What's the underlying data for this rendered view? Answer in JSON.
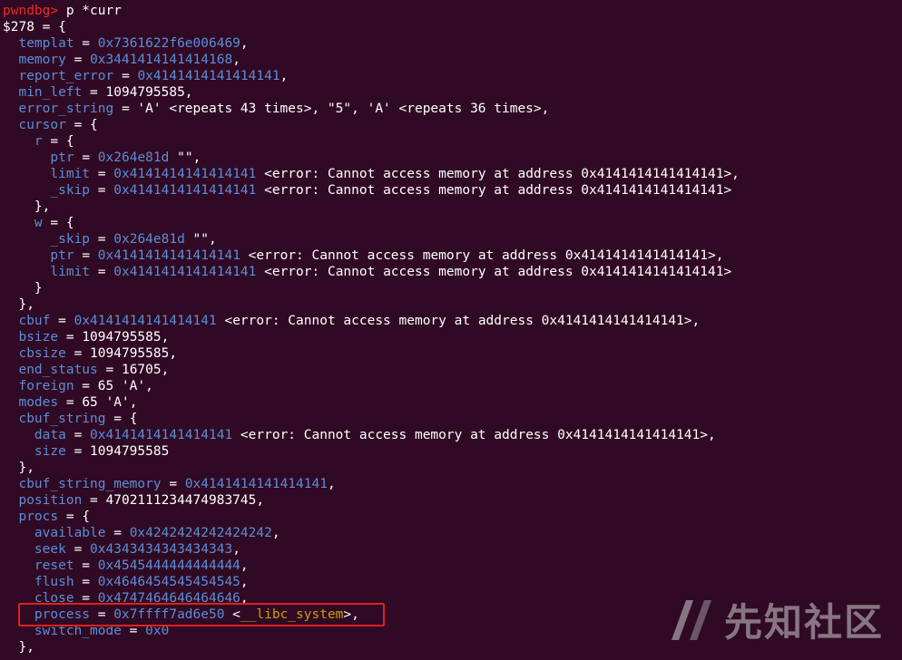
{
  "terminal": {
    "lines": [
      [
        {
          "t": "pwndbg>",
          "c": "prompt"
        },
        {
          "t": " p *curr",
          "c": "text"
        }
      ],
      [
        {
          "t": "$278 = {",
          "c": "text"
        }
      ],
      [
        {
          "t": "  ",
          "c": "text"
        },
        {
          "t": "templat",
          "c": "field"
        },
        {
          "t": " = ",
          "c": "text"
        },
        {
          "t": "0x7361622f6e006469",
          "c": "addr"
        },
        {
          "t": ",",
          "c": "text"
        }
      ],
      [
        {
          "t": "  ",
          "c": "text"
        },
        {
          "t": "memory",
          "c": "field"
        },
        {
          "t": " = ",
          "c": "text"
        },
        {
          "t": "0x3441414141414168",
          "c": "addr"
        },
        {
          "t": ",",
          "c": "text"
        }
      ],
      [
        {
          "t": "  ",
          "c": "text"
        },
        {
          "t": "report_error",
          "c": "field"
        },
        {
          "t": " = ",
          "c": "text"
        },
        {
          "t": "0x4141414141414141",
          "c": "addr"
        },
        {
          "t": ",",
          "c": "text"
        }
      ],
      [
        {
          "t": "  ",
          "c": "text"
        },
        {
          "t": "min_left",
          "c": "field"
        },
        {
          "t": " = 1094795585,",
          "c": "text"
        }
      ],
      [
        {
          "t": "  ",
          "c": "text"
        },
        {
          "t": "error_string",
          "c": "field"
        },
        {
          "t": " = 'A' <repeats 43 times>, \"5\", 'A' <repeats 36 times>,",
          "c": "text"
        }
      ],
      [
        {
          "t": "  ",
          "c": "text"
        },
        {
          "t": "cursor",
          "c": "field"
        },
        {
          "t": " = {",
          "c": "text"
        }
      ],
      [
        {
          "t": "    ",
          "c": "text"
        },
        {
          "t": "r",
          "c": "field"
        },
        {
          "t": " = {",
          "c": "text"
        }
      ],
      [
        {
          "t": "      ",
          "c": "text"
        },
        {
          "t": "ptr",
          "c": "field"
        },
        {
          "t": " = ",
          "c": "text"
        },
        {
          "t": "0x264e81d",
          "c": "addr"
        },
        {
          "t": " \"\",",
          "c": "text"
        }
      ],
      [
        {
          "t": "      ",
          "c": "text"
        },
        {
          "t": "limit",
          "c": "field"
        },
        {
          "t": " = ",
          "c": "text"
        },
        {
          "t": "0x4141414141414141",
          "c": "addr"
        },
        {
          "t": " <error: Cannot access memory at address 0x4141414141414141>,",
          "c": "text"
        }
      ],
      [
        {
          "t": "      ",
          "c": "text"
        },
        {
          "t": "_skip",
          "c": "field"
        },
        {
          "t": " = ",
          "c": "text"
        },
        {
          "t": "0x4141414141414141",
          "c": "addr"
        },
        {
          "t": " <error: Cannot access memory at address 0x4141414141414141>",
          "c": "text"
        }
      ],
      [
        {
          "t": "    },",
          "c": "text"
        }
      ],
      [
        {
          "t": "    ",
          "c": "text"
        },
        {
          "t": "w",
          "c": "field"
        },
        {
          "t": " = {",
          "c": "text"
        }
      ],
      [
        {
          "t": "      ",
          "c": "text"
        },
        {
          "t": "_skip",
          "c": "field"
        },
        {
          "t": " = ",
          "c": "text"
        },
        {
          "t": "0x264e81d",
          "c": "addr"
        },
        {
          "t": " \"\",",
          "c": "text"
        }
      ],
      [
        {
          "t": "      ",
          "c": "text"
        },
        {
          "t": "ptr",
          "c": "field"
        },
        {
          "t": " = ",
          "c": "text"
        },
        {
          "t": "0x4141414141414141",
          "c": "addr"
        },
        {
          "t": " <error: Cannot access memory at address 0x4141414141414141>,",
          "c": "text"
        }
      ],
      [
        {
          "t": "      ",
          "c": "text"
        },
        {
          "t": "limit",
          "c": "field"
        },
        {
          "t": " = ",
          "c": "text"
        },
        {
          "t": "0x4141414141414141",
          "c": "addr"
        },
        {
          "t": " <error: Cannot access memory at address 0x4141414141414141>",
          "c": "text"
        }
      ],
      [
        {
          "t": "    }",
          "c": "text"
        }
      ],
      [
        {
          "t": "  },",
          "c": "text"
        }
      ],
      [
        {
          "t": "  ",
          "c": "text"
        },
        {
          "t": "cbuf",
          "c": "field"
        },
        {
          "t": " = ",
          "c": "text"
        },
        {
          "t": "0x4141414141414141",
          "c": "addr"
        },
        {
          "t": " <error: Cannot access memory at address 0x4141414141414141>,",
          "c": "text"
        }
      ],
      [
        {
          "t": "  ",
          "c": "text"
        },
        {
          "t": "bsize",
          "c": "field"
        },
        {
          "t": " = 1094795585,",
          "c": "text"
        }
      ],
      [
        {
          "t": "  ",
          "c": "text"
        },
        {
          "t": "cbsize",
          "c": "field"
        },
        {
          "t": " = 1094795585,",
          "c": "text"
        }
      ],
      [
        {
          "t": "  ",
          "c": "text"
        },
        {
          "t": "end_status",
          "c": "field"
        },
        {
          "t": " = 16705,",
          "c": "text"
        }
      ],
      [
        {
          "t": "  ",
          "c": "text"
        },
        {
          "t": "foreign",
          "c": "field"
        },
        {
          "t": " = 65 'A',",
          "c": "text"
        }
      ],
      [
        {
          "t": "  ",
          "c": "text"
        },
        {
          "t": "modes",
          "c": "field"
        },
        {
          "t": " = 65 'A',",
          "c": "text"
        }
      ],
      [
        {
          "t": "  ",
          "c": "text"
        },
        {
          "t": "cbuf_string",
          "c": "field"
        },
        {
          "t": " = {",
          "c": "text"
        }
      ],
      [
        {
          "t": "    ",
          "c": "text"
        },
        {
          "t": "data",
          "c": "field"
        },
        {
          "t": " = ",
          "c": "text"
        },
        {
          "t": "0x4141414141414141",
          "c": "addr"
        },
        {
          "t": " <error: Cannot access memory at address 0x4141414141414141>,",
          "c": "text"
        }
      ],
      [
        {
          "t": "    ",
          "c": "text"
        },
        {
          "t": "size",
          "c": "field"
        },
        {
          "t": " = 1094795585",
          "c": "text"
        }
      ],
      [
        {
          "t": "  },",
          "c": "text"
        }
      ],
      [
        {
          "t": "  ",
          "c": "text"
        },
        {
          "t": "cbuf_string_memory",
          "c": "field"
        },
        {
          "t": " = ",
          "c": "text"
        },
        {
          "t": "0x4141414141414141",
          "c": "addr"
        },
        {
          "t": ",",
          "c": "text"
        }
      ],
      [
        {
          "t": "  ",
          "c": "text"
        },
        {
          "t": "position",
          "c": "field"
        },
        {
          "t": " = 4702111234474983745,",
          "c": "text"
        }
      ],
      [
        {
          "t": "  ",
          "c": "text"
        },
        {
          "t": "procs",
          "c": "field"
        },
        {
          "t": " = {",
          "c": "text"
        }
      ],
      [
        {
          "t": "    ",
          "c": "text"
        },
        {
          "t": "available",
          "c": "field"
        },
        {
          "t": " = ",
          "c": "text"
        },
        {
          "t": "0x4242424242424242",
          "c": "addr"
        },
        {
          "t": ",",
          "c": "text"
        }
      ],
      [
        {
          "t": "    ",
          "c": "text"
        },
        {
          "t": "seek",
          "c": "field"
        },
        {
          "t": " = ",
          "c": "text"
        },
        {
          "t": "0x4343434343434343",
          "c": "addr"
        },
        {
          "t": ",",
          "c": "text"
        }
      ],
      [
        {
          "t": "    ",
          "c": "text"
        },
        {
          "t": "reset",
          "c": "field"
        },
        {
          "t": " = ",
          "c": "text"
        },
        {
          "t": "0x4545444444444444",
          "c": "addr"
        },
        {
          "t": ",",
          "c": "text"
        }
      ],
      [
        {
          "t": "    ",
          "c": "text"
        },
        {
          "t": "flush",
          "c": "field"
        },
        {
          "t": " = ",
          "c": "text"
        },
        {
          "t": "0x4646454545454545",
          "c": "addr"
        },
        {
          "t": ",",
          "c": "text"
        }
      ],
      [
        {
          "t": "    ",
          "c": "text"
        },
        {
          "t": "close",
          "c": "field"
        },
        {
          "t": " = ",
          "c": "text"
        },
        {
          "t": "0x4747464646464646",
          "c": "addr"
        },
        {
          "t": ",",
          "c": "text"
        }
      ],
      [
        {
          "t": "    ",
          "c": "text"
        },
        {
          "t": "process",
          "c": "field"
        },
        {
          "t": " = ",
          "c": "text"
        },
        {
          "t": "0x7ffff7ad6e50",
          "c": "addr"
        },
        {
          "t": " <",
          "c": "text"
        },
        {
          "t": "__libc_system",
          "c": "sym"
        },
        {
          "t": ">,",
          "c": "text"
        }
      ],
      [
        {
          "t": "    ",
          "c": "text"
        },
        {
          "t": "switch_mode",
          "c": "field"
        },
        {
          "t": " = ",
          "c": "text"
        },
        {
          "t": "0x0",
          "c": "addr"
        }
      ],
      [
        {
          "t": "  },",
          "c": "text"
        }
      ]
    ]
  },
  "watermark": {
    "text": "先知社区",
    "icon": "xianzhi-logo-icon"
  },
  "colors": {
    "background": "#300a24",
    "field": "#5c8dd6",
    "text": "#ffffff",
    "prompt": "#ef2929",
    "symbol": "#c4a000",
    "highlight": "#e0201c"
  }
}
